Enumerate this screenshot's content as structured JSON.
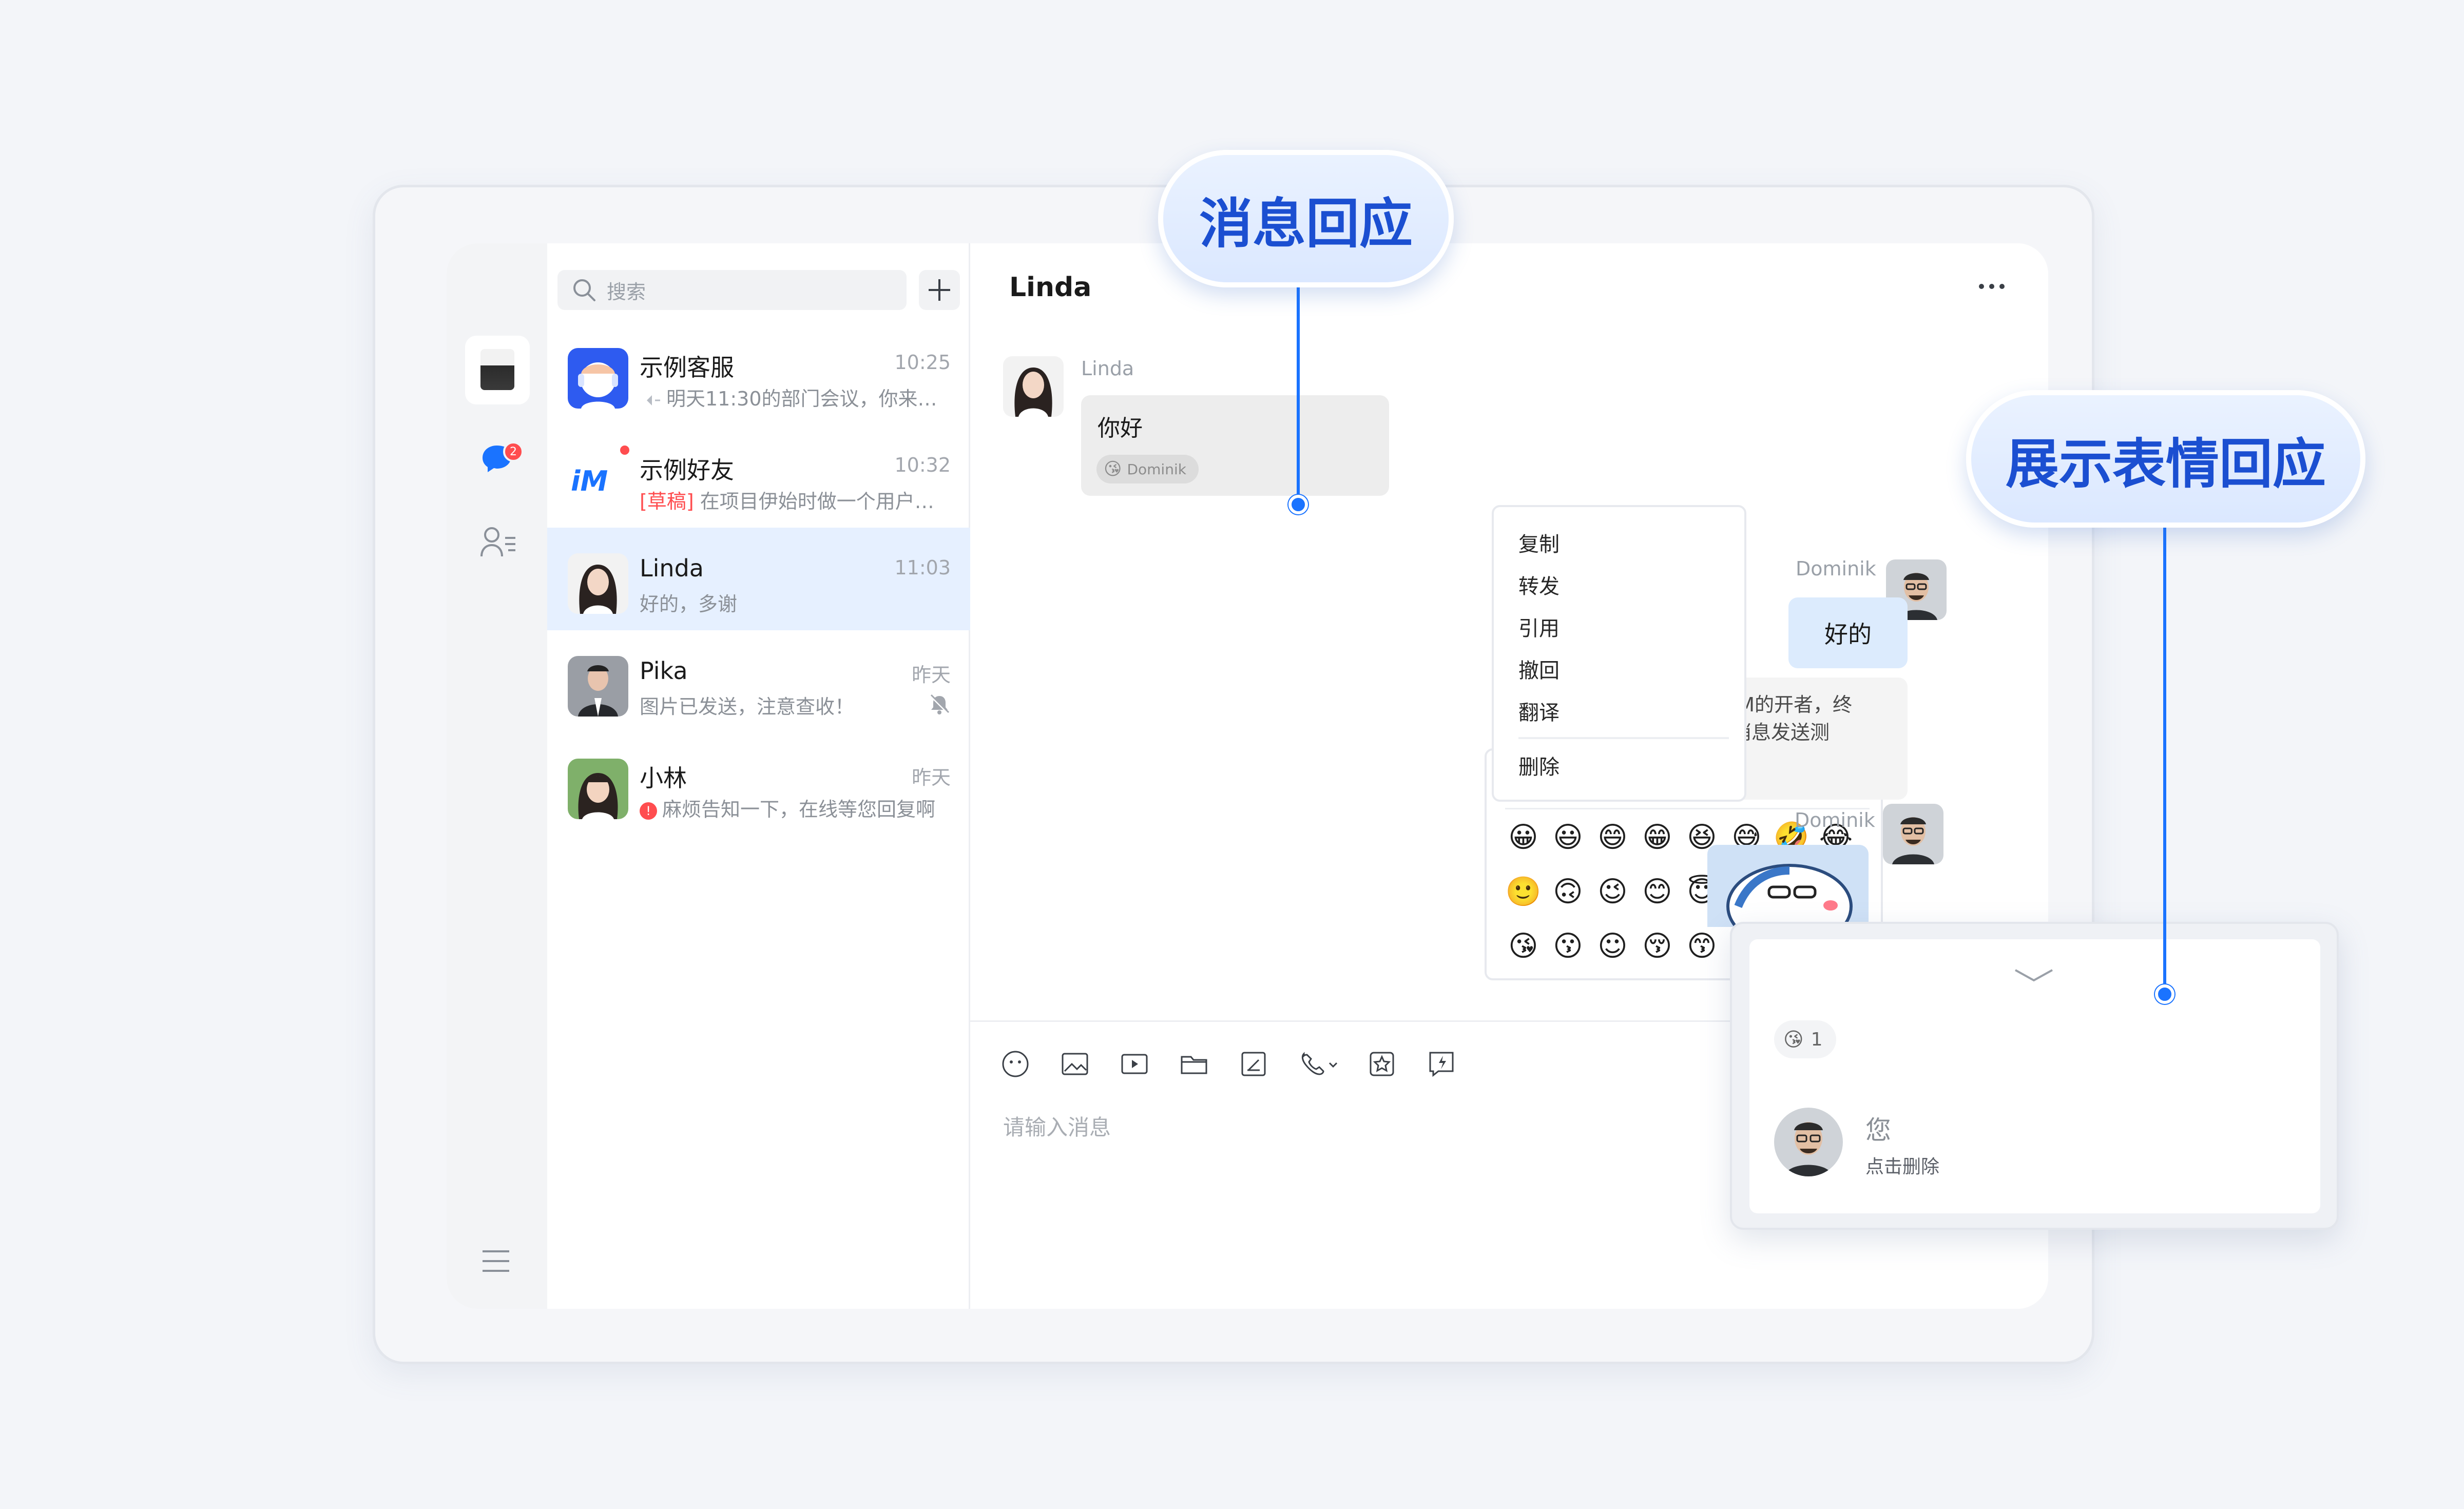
{
  "callouts": {
    "message_reaction": "消息回应",
    "show_reactions": "展示表情回应"
  },
  "rail": {
    "unread_badge": "2"
  },
  "search": {
    "placeholder": "搜索"
  },
  "conversations": [
    {
      "name": "示例客服",
      "time": "10:25",
      "preview": "明天11:30的部门会议，你来参加吗",
      "has_voice_prefix": true
    },
    {
      "name": "示例好友",
      "time": "10:32",
      "draft_tag": "[草稿]",
      "preview": "在项目伊始时做一个用户调研"
    },
    {
      "name": "Linda",
      "time": "11:03",
      "preview": "好的，多谢",
      "active": true
    },
    {
      "name": "Pika",
      "time": "昨天",
      "preview": "图片已发送，注意查收！",
      "muted": true
    },
    {
      "name": "小林",
      "time": "昨天",
      "error_mark": "!",
      "preview": "麻烦告知一下，在线等您回复啊"
    }
  ],
  "chat": {
    "title": "Linda",
    "messages": [
      {
        "sender": "Linda",
        "text": "你好",
        "reaction_emoji": "😘",
        "reaction_user": "Dominik"
      },
      {
        "sender": "Dominik",
        "text": "好的"
      },
      {
        "text_line1": "对通讯IM的开者，终",
        "text_line2": "框进行消息发送测"
      },
      {
        "sender": "Dominik",
        "type": "sticker"
      }
    ],
    "input_placeholder": "请输入消息"
  },
  "emoji_panel": {
    "recent": [
      "😁",
      "😛",
      "😅",
      "😲",
      "😑",
      "🌹"
    ],
    "grid": [
      [
        "😀",
        "😃",
        "😄",
        "😁",
        "😆",
        "😅",
        "🤣",
        "😂"
      ],
      [
        "🙂",
        "🙃",
        "😉",
        "😊",
        "😇",
        "🥰",
        "😍",
        "🤩"
      ],
      [
        "😘",
        "😗",
        "☺",
        "😚",
        "😙",
        "🥲",
        "😋",
        "🤓"
      ]
    ]
  },
  "context_menu": {
    "items": [
      "复制",
      "转发",
      "引用",
      "撤回",
      "翻译"
    ],
    "danger_item": "删除"
  },
  "reaction_popup": {
    "emoji": "😘",
    "count": "1",
    "user_name": "您",
    "hint": "点击删除"
  },
  "colors": {
    "accent": "#1a73ff",
    "active_row": "#e6f0ff",
    "callout_text": "#1b4fd1",
    "badge": "#ff4d4f"
  }
}
